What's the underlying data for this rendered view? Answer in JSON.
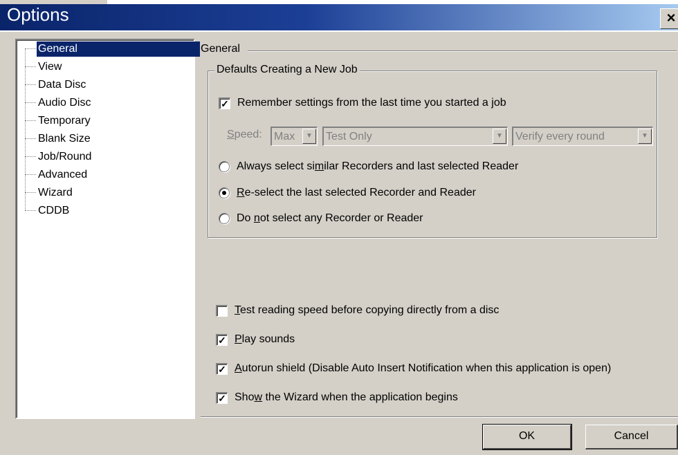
{
  "window": {
    "title": "Options",
    "close_glyph": "×"
  },
  "tree": {
    "items": [
      {
        "label": "General",
        "selected": true
      },
      {
        "label": "View"
      },
      {
        "label": "Data Disc"
      },
      {
        "label": "Audio Disc"
      },
      {
        "label": "Temporary"
      },
      {
        "label": "Blank Size"
      },
      {
        "label": "Job/Round"
      },
      {
        "label": "Advanced"
      },
      {
        "label": "Wizard"
      },
      {
        "label": "CDDB"
      }
    ]
  },
  "section": {
    "title": "General"
  },
  "group": {
    "legend": "Defaults Creating a New Job",
    "remember": {
      "label": "Remember settings from the last time you started a job",
      "checked": true
    },
    "speed": {
      "label_pre": "",
      "label_u": "S",
      "label_post": "peed:",
      "speed_value": "Max",
      "mode_value": "Test Only",
      "verify_value": "Verify every round"
    },
    "radios": [
      {
        "pre": "Always select si",
        "u": "m",
        "post": "ilar Recorders and last selected Reader",
        "selected": false
      },
      {
        "pre": "",
        "u": "R",
        "post": "e-select the last selected Recorder and Reader",
        "selected": true
      },
      {
        "pre": "Do ",
        "u": "n",
        "post": "ot select any Recorder or Reader",
        "selected": false
      }
    ]
  },
  "options": [
    {
      "pre": "",
      "u": "T",
      "post": "est reading speed before copying directly from a disc",
      "checked": false
    },
    {
      "pre": "",
      "u": "P",
      "post": "lay sounds",
      "checked": true
    },
    {
      "pre": "",
      "u": "A",
      "post": "utorun shield (Disable Auto Insert Notification when this application is open)",
      "checked": true
    },
    {
      "pre": "Sho",
      "u": "w",
      "post": " the Wizard when the application begins",
      "checked": true
    }
  ],
  "buttons": {
    "ok": "OK",
    "cancel": "Cancel"
  },
  "colors": {
    "titlebar": "#0a246a",
    "face": "#d4d0c8",
    "selection": "#0a246a"
  }
}
